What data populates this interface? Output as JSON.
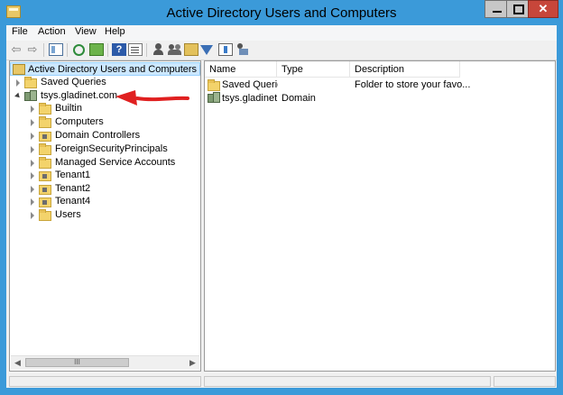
{
  "window": {
    "title": "Active Directory Users and Computers"
  },
  "menu": [
    "File",
    "Action",
    "View",
    "Help"
  ],
  "toolbar": {
    "icons": [
      "back-icon",
      "forward-icon",
      "show-hide-console-tree-icon",
      "refresh-icon",
      "export-list-icon",
      "help-icon",
      "properties-icon",
      "new-user-icon",
      "new-group-icon",
      "new-ou-icon",
      "filter-icon",
      "query-icon",
      "delegate-control-icon"
    ]
  },
  "tree": {
    "root": "Active Directory Users and Computers [WIN-I",
    "saved_queries": "Saved Queries",
    "domain": "tsys.gladinet.com",
    "children": [
      "Builtin",
      "Computers",
      "Domain Controllers",
      "ForeignSecurityPrincipals",
      "Managed Service Accounts",
      "Tenant1",
      "Tenant2",
      "Tenant4",
      "Users"
    ]
  },
  "list": {
    "columns": [
      "Name",
      "Type",
      "Description"
    ],
    "rows": [
      {
        "name": "Saved Queries",
        "type": "",
        "description": "Folder to store your favo..."
      },
      {
        "name": "tsys.gladinet...",
        "type": "Domain",
        "description": ""
      }
    ]
  },
  "scrollbar": {
    "thumb_grip": "III"
  },
  "annotation": {
    "arrow_color": "#e02020"
  }
}
